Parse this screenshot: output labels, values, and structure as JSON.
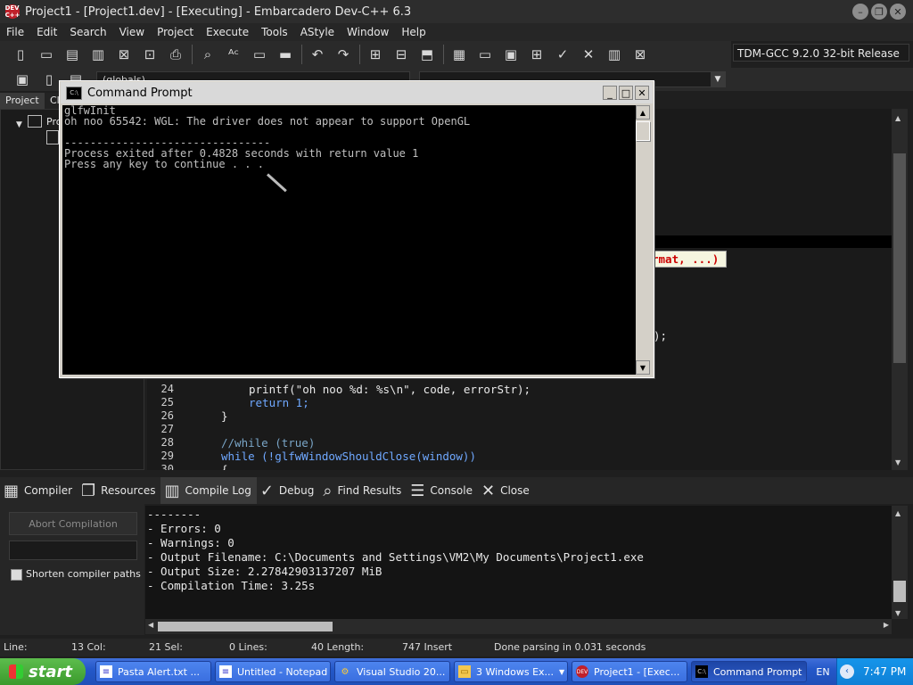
{
  "window": {
    "title": "Project1 - [Project1.dev] - [Executing] - Embarcadero Dev-C++ 6.3",
    "logo_text": "DEV C++"
  },
  "menu": [
    "File",
    "Edit",
    "Search",
    "View",
    "Project",
    "Execute",
    "Tools",
    "AStyle",
    "Window",
    "Help"
  ],
  "toolbar": {
    "compiler_select": "TDM-GCC 9.2.0 32-bit Release",
    "scope_select": "(globals)"
  },
  "left_tabs": {
    "project": "Project",
    "classes": "Cl",
    "tree_root": "Pro"
  },
  "editor": {
    "lines": [
      {
        "num": "24",
        "code": "printf(\"oh noo %d: %s\\n\", code, errorStr);"
      },
      {
        "num": "25",
        "code": "return 1;"
      },
      {
        "num": "26",
        "code": "}"
      },
      {
        "num": "27",
        "code": ""
      },
      {
        "num": "28",
        "code": "//while (true)"
      },
      {
        "num": "29",
        "code": "while (!glfwWindowShouldClose(window))"
      },
      {
        "num": "30",
        "code": "{"
      }
    ],
    "hint": "rmat, ...)",
    "partial_line": ");"
  },
  "console": {
    "title": "Command Prompt",
    "icon_text": "C:\\",
    "lines": [
      "glfwInit",
      "oh noo 65542: WGL: The driver does not appear to support OpenGL",
      "",
      "--------------------------------",
      "Process exited after 0.4828 seconds with return value 1",
      "Press any key to continue . . ."
    ]
  },
  "bottom_tabs": [
    {
      "label": "Compiler",
      "icon": "grid-icon"
    },
    {
      "label": "Resources",
      "icon": "copy-icon"
    },
    {
      "label": "Compile Log",
      "icon": "chart-icon"
    },
    {
      "label": "Debug",
      "icon": "check-icon"
    },
    {
      "label": "Find Results",
      "icon": "search-doc-icon"
    },
    {
      "label": "Console",
      "icon": "list-icon"
    },
    {
      "label": "Close",
      "icon": "close-icon"
    }
  ],
  "compile": {
    "abort_label": "Abort Compilation",
    "shorten_label": "Shorten compiler paths",
    "log": [
      "--------",
      "- Errors: 0",
      "- Warnings: 0",
      "- Output Filename: C:\\Documents and Settings\\VM2\\My Documents\\Project1.exe",
      "- Output Size: 2.27842903137207 MiB",
      "- Compilation Time: 3.25s"
    ]
  },
  "status": {
    "line": "Line:",
    "col": "13 Col:",
    "sel": "21 Sel:",
    "lines": "0 Lines:",
    "length": "40 Length:",
    "mode": "747 Insert",
    "parse": "Done parsing in 0.031 seconds"
  },
  "taskbar": {
    "start": "start",
    "tasks": [
      {
        "label": "Pasta Alert.txt ...",
        "icon": "notepad-icon"
      },
      {
        "label": "Untitled - Notepad",
        "icon": "notepad-icon"
      },
      {
        "label": "Visual Studio 20...",
        "icon": "visual-studio-icon"
      },
      {
        "label": "3 Windows Ex...",
        "icon": "folder-icon"
      },
      {
        "label": "Project1 - [Exec...",
        "icon": "devcpp-icon"
      },
      {
        "label": "Command Prompt",
        "icon": "cmd-icon"
      }
    ],
    "lang": "EN",
    "time": "7:47 PM"
  }
}
